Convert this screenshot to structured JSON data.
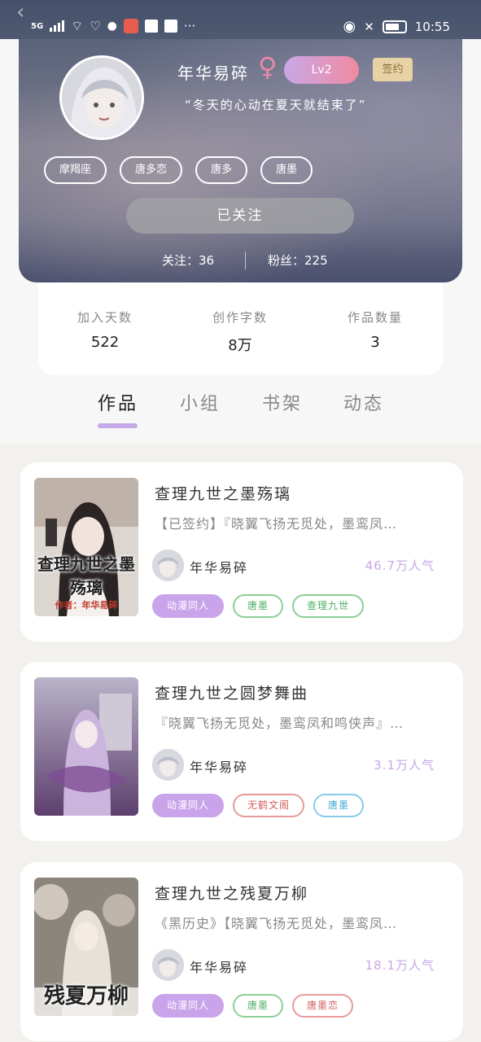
{
  "status_bar": {
    "network": "5G",
    "time": "10:55",
    "more": "···"
  },
  "profile": {
    "username": "年华易碎",
    "gender_symbol": "♀",
    "level": "Lv2",
    "signed_label": "签约",
    "motto": "“冬天的心动在夏天就结束了”",
    "tags": [
      "摩羯座",
      "唐多恋",
      "唐多",
      "唐墨"
    ],
    "follow_button": "已关注",
    "following": "关注：36",
    "fans": "粉丝：225"
  },
  "stats": {
    "days": {
      "label": "加入天数",
      "value": "522"
    },
    "words": {
      "label": "创作字数",
      "value": "8万"
    },
    "works": {
      "label": "作品数量",
      "value": "3"
    }
  },
  "tabs": [
    "作品",
    "小组",
    "书架",
    "动态"
  ],
  "active_tab": 0,
  "works": [
    {
      "title": "查理九世之墨殇璃",
      "desc": "【已签约】『晓翼飞扬无觅处，墨鸾凤…",
      "author": "年华易碎",
      "popularity": "46.7万人气",
      "cover_title": "查理九世之墨殇璃",
      "cover_author": "作者：年华易碎",
      "tags": [
        {
          "label": "动漫同人",
          "style": "purple"
        },
        {
          "label": "唐墨",
          "style": "green"
        },
        {
          "label": "查理九世",
          "style": "green"
        }
      ]
    },
    {
      "title": "查理九世之圆梦舞曲",
      "desc": "『晓翼飞扬无觅处，墨鸾凤和鸣侠声』…",
      "author": "年华易碎",
      "popularity": "3.1万人气",
      "cover_title": "",
      "cover_author": "",
      "tags": [
        {
          "label": "动漫同人",
          "style": "purple"
        },
        {
          "label": "无鹤文阁",
          "style": "red"
        },
        {
          "label": "唐墨",
          "style": "blue"
        }
      ]
    },
    {
      "title": "查理九世之残夏万柳",
      "desc": "《黑历史》【晓翼飞扬无觅处，墨鸾凤…",
      "author": "年华易碎",
      "popularity": "18.1万人气",
      "cover_title": "残夏万柳",
      "cover_author": "",
      "tags": [
        {
          "label": "动漫同人",
          "style": "purple"
        },
        {
          "label": "唐墨",
          "style": "green"
        },
        {
          "label": "唐墨恋",
          "style": "red"
        }
      ]
    }
  ],
  "colors": {
    "accent_purple": "#c6a9e8",
    "tag_green": "#4caf63",
    "tag_red": "#d45f5f",
    "tag_blue": "#3ea7d4",
    "signed_gold": "#e6d2a5"
  }
}
